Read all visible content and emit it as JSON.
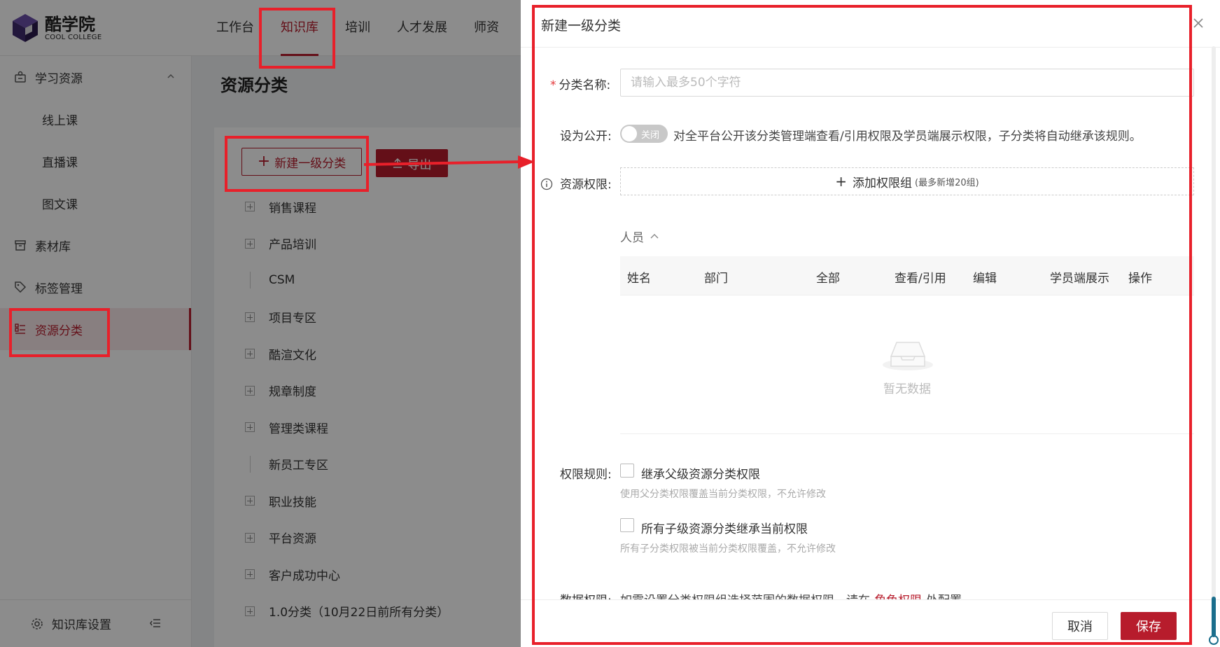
{
  "brand": {
    "name": "酷学院",
    "tagline": "COOL COLLEGE"
  },
  "topnav": [
    "工作台",
    "知识库",
    "培训",
    "人才发展",
    "师资"
  ],
  "sidebar": {
    "group_learning": "学习资源",
    "sub_items": [
      "线上课",
      "直播课",
      "图文课"
    ],
    "materials": "素材库",
    "tags": "标签管理",
    "categories": "资源分类",
    "footer": "知识库设置"
  },
  "page": {
    "title": "资源分类",
    "new_button": "新建一级分类",
    "export_button": "导出",
    "tree": [
      {
        "label": "销售课程",
        "type": "expand"
      },
      {
        "label": "产品培训",
        "type": "expand"
      },
      {
        "label": "CSM",
        "type": "leaf"
      },
      {
        "label": "项目专区",
        "type": "expand"
      },
      {
        "label": "酷渲文化",
        "type": "expand"
      },
      {
        "label": "规章制度",
        "type": "expand"
      },
      {
        "label": "管理类课程",
        "type": "expand"
      },
      {
        "label": "新员工专区",
        "type": "leaf"
      },
      {
        "label": "职业技能",
        "type": "expand"
      },
      {
        "label": "平台资源",
        "type": "expand"
      },
      {
        "label": "客户成功中心",
        "type": "expand"
      },
      {
        "label": "1.0分类（10月22日前所有分类）",
        "type": "expand"
      }
    ]
  },
  "drawer": {
    "title": "新建一级分类",
    "name_label": "分类名称:",
    "name_placeholder": "请输入最多50个字符",
    "public_label": "设为公开:",
    "toggle_text": "关闭",
    "public_desc": "对全平台公开该分类管理端查看/引用权限及学员端展示权限，子分类将自动继承该规则。",
    "perm_label": "资源权限:",
    "add_group": "添加权限组",
    "add_group_hint": "(最多新增20组)",
    "people_label": "人员",
    "columns": [
      "姓名",
      "部门",
      "全部",
      "查看/引用",
      "编辑",
      "学员端展示",
      "操作"
    ],
    "empty_text": "暂无数据",
    "rules_label": "权限规则:",
    "rule1": "继承父级资源分类权限",
    "rule1_hint": "使用父分类权限覆盖当前分类权限，不允许修改",
    "rule2": "所有子级资源分类继承当前权限",
    "rule2_hint": "所有子分类权限被当前分类权限覆盖，不允许修改",
    "data_label": "数据权限:",
    "data_text_before": "如需设置分类权限组选择范围的数据权限，请在",
    "data_link": "角色权限",
    "data_text_after": "处配置。",
    "cancel": "取消",
    "save": "保存"
  },
  "colors": {
    "brand": "#b71c2c",
    "annotation": "#e8202a",
    "logo": "#3f2a6e"
  }
}
